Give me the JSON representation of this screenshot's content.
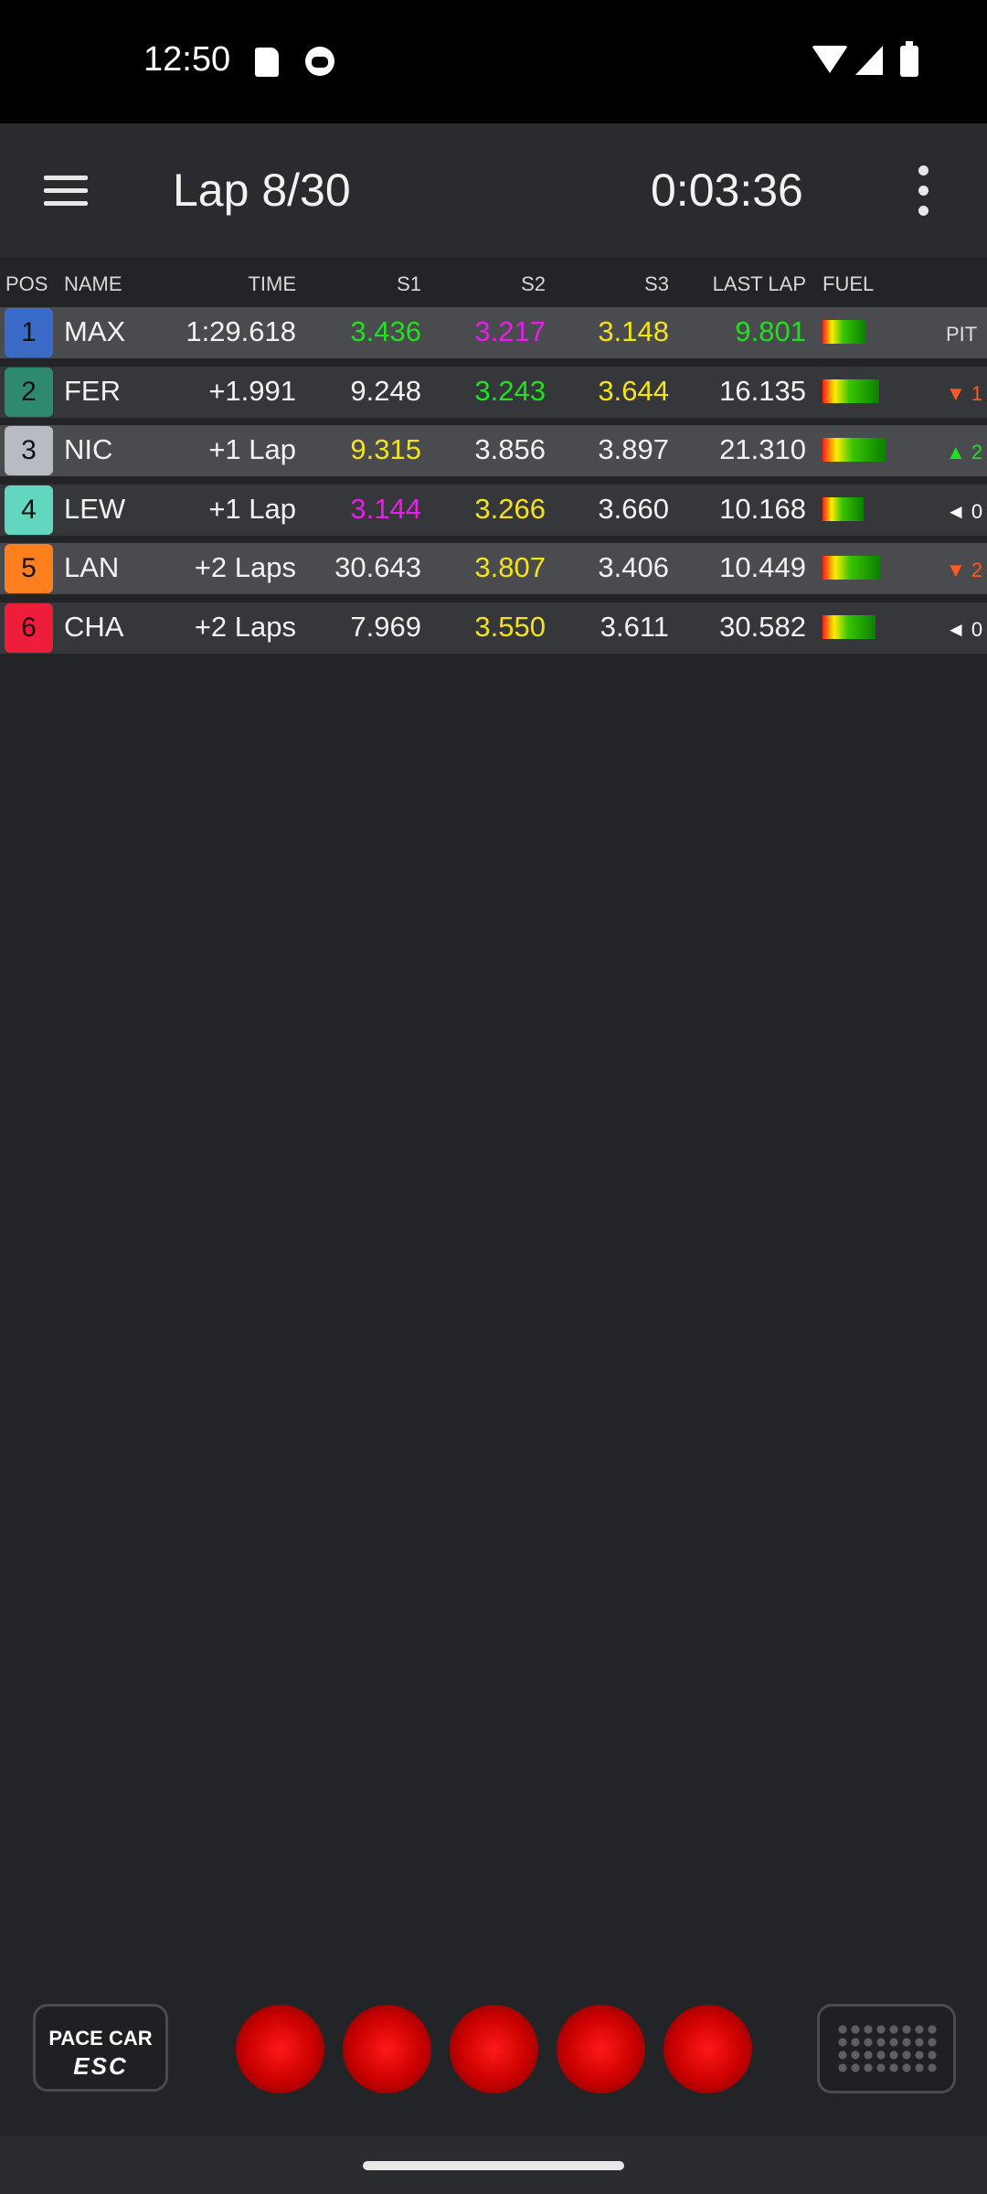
{
  "status_bar": {
    "time": "12:50"
  },
  "app_bar": {
    "lap": "Lap 8/30",
    "timer": "0:03:36"
  },
  "table": {
    "headers": {
      "pos": "POS",
      "name": "NAME",
      "time": "TIME",
      "s1": "S1",
      "s2": "S2",
      "s3": "S3",
      "last_lap": "LAST LAP",
      "fuel": "FUEL"
    },
    "rows": [
      {
        "pos": "1",
        "pos_color": "#3a6bc9",
        "name": "MAX",
        "time": "1:29.618",
        "s1": "3.436",
        "s1_color": "#21e021",
        "s2": "3.217",
        "s2_color": "#e81ee8",
        "s3": "3.148",
        "s3_color": "#f4e21a",
        "last": "9.801",
        "last_color": "#21e021",
        "fuel": 0.42,
        "status": "PIT",
        "status_color": "#dddddd"
      },
      {
        "pos": "2",
        "pos_color": "#2e8a6e",
        "name": "FER",
        "time": "+1.991",
        "s1": "9.248",
        "s1_color": "#f2f2f2",
        "s2": "3.243",
        "s2_color": "#21e021",
        "s3": "3.644",
        "s3_color": "#f4e21a",
        "last": "16.135",
        "last_color": "#f2f2f2",
        "fuel": 0.55,
        "status": "▼ 1",
        "status_color": "#ff5a1f"
      },
      {
        "pos": "3",
        "pos_color": "#b8bcc2",
        "name": "NIC",
        "time": "+1 Lap",
        "s1": "9.315",
        "s1_color": "#f4e21a",
        "s2": "3.856",
        "s2_color": "#f2f2f2",
        "s3": "3.897",
        "s3_color": "#f2f2f2",
        "last": "21.310",
        "last_color": "#f2f2f2",
        "fuel": 0.62,
        "status": "▲ 2",
        "status_color": "#21e021"
      },
      {
        "pos": "4",
        "pos_color": "#63d6bf",
        "name": "LEW",
        "time": "+1 Lap",
        "s1": "3.144",
        "s1_color": "#e81ee8",
        "s2": "3.266",
        "s2_color": "#f4e21a",
        "s3": "3.660",
        "s3_color": "#f2f2f2",
        "last": "10.168",
        "last_color": "#f2f2f2",
        "fuel": 0.4,
        "status": "◄ 0",
        "status_color": "#ffffff"
      },
      {
        "pos": "5",
        "pos_color": "#ff7f1e",
        "name": "LAN",
        "time": "+2 Laps",
        "s1": "30.643",
        "s1_color": "#f2f2f2",
        "s2": "3.807",
        "s2_color": "#f4e21a",
        "s3": "3.406",
        "s3_color": "#f2f2f2",
        "last": "10.449",
        "last_color": "#f2f2f2",
        "fuel": 0.56,
        "status": "▼ 2",
        "status_color": "#ff5a1f"
      },
      {
        "pos": "6",
        "pos_color": "#ee1e3a",
        "name": "CHA",
        "time": "+2 Laps",
        "s1": "7.969",
        "s1_color": "#f2f2f2",
        "s2": "3.550",
        "s2_color": "#f4e21a",
        "s3": "3.611",
        "s3_color": "#f2f2f2",
        "last": "30.582",
        "last_color": "#f2f2f2",
        "fuel": 0.52,
        "status": "◄ 0",
        "status_color": "#ffffff"
      }
    ]
  },
  "controls": {
    "pace_car": {
      "line1": "PACE CAR",
      "line2": "ESC"
    },
    "start_lights": [
      "light-1",
      "light-2",
      "light-3",
      "light-4",
      "light-5"
    ],
    "light_color": "#e00000"
  }
}
